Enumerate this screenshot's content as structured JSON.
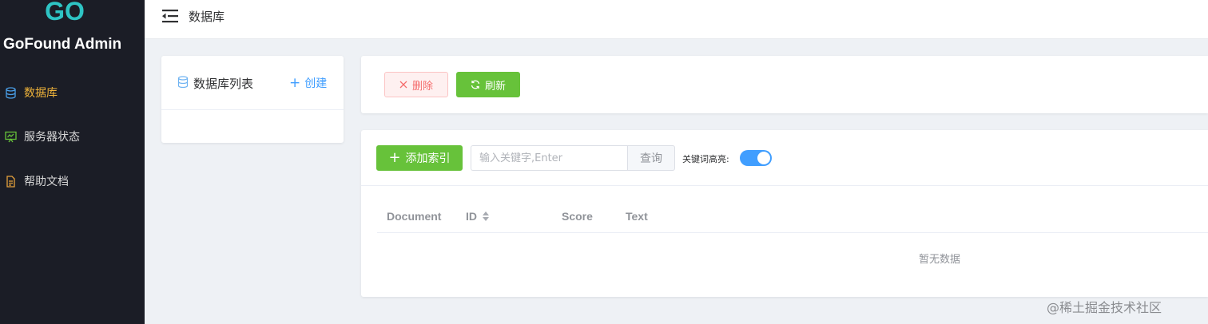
{
  "sidebar": {
    "brand": "GoFound Admin",
    "logo_text": "GO",
    "items": [
      {
        "label": "数据库",
        "icon": "database-icon",
        "active": true
      },
      {
        "label": "服务器状态",
        "icon": "monitor-icon",
        "active": false
      },
      {
        "label": "帮助文档",
        "icon": "document-icon",
        "active": false
      }
    ]
  },
  "header": {
    "title": "数据库"
  },
  "db_panel": {
    "title": "数据库列表",
    "create_label": "创建"
  },
  "actions": {
    "delete_label": "删除",
    "refresh_label": "刷新"
  },
  "index": {
    "add_label": "添加索引",
    "search_placeholder": "输入关键字,Enter",
    "search_value": "",
    "query_label": "查询",
    "highlight_label": "关键词高亮:",
    "highlight_on": true
  },
  "table": {
    "columns": [
      "Document",
      "ID",
      "Score",
      "Text"
    ],
    "empty_text": "暂无数据"
  },
  "watermark": "@稀土掘金技术社区",
  "colors": {
    "sidebar_bg": "#1b1d26",
    "active_nav": "#f0b43a",
    "primary": "#409eff",
    "success": "#67c23a",
    "danger": "#f56c6c",
    "logo": "#2ec4c4"
  }
}
